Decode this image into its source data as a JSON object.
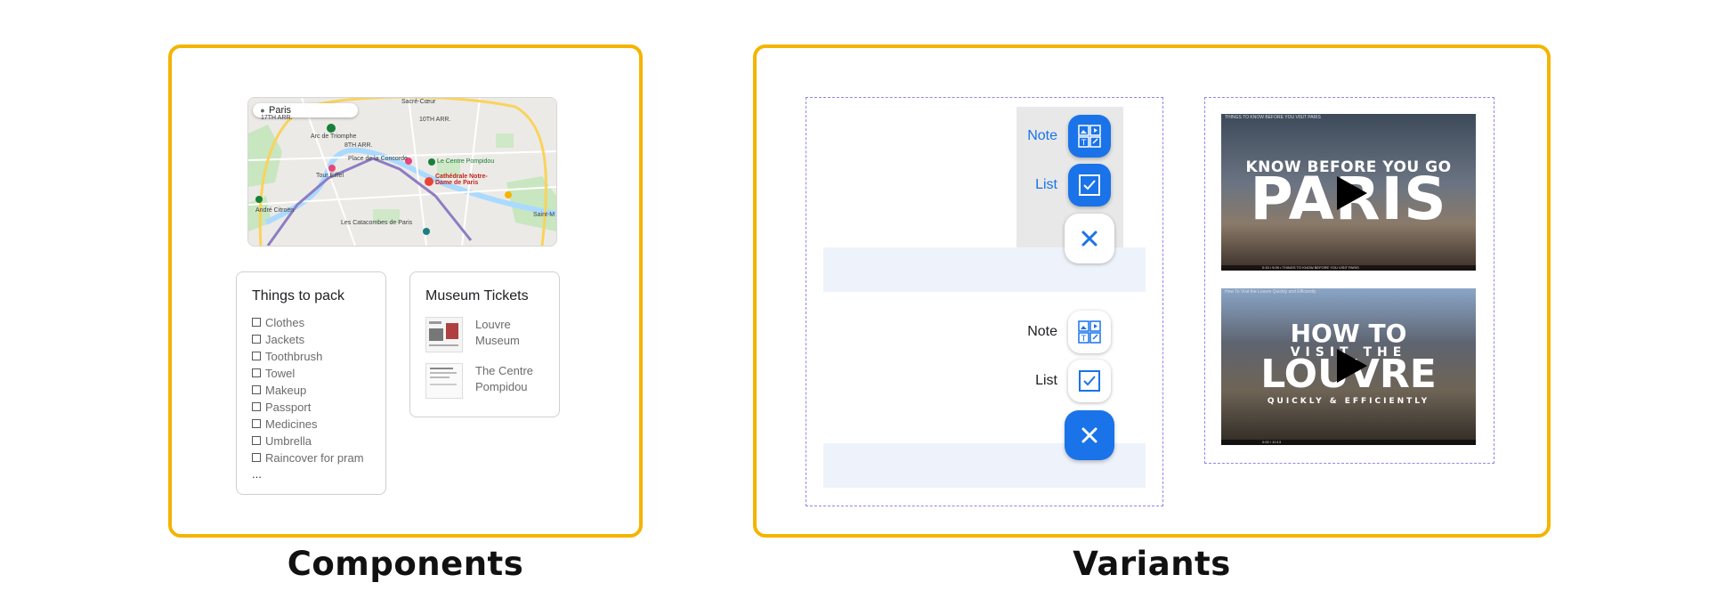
{
  "captions": {
    "components": "Components",
    "variants": "Variants"
  },
  "map": {
    "search": "Paris",
    "labels": {
      "sacre_coeur": "Sacré-Cœur",
      "tenth": "10TH ARR.",
      "seventeenth": "17TH ARR.",
      "arc": "Arc de Triomphe",
      "eighth": "8TH ARR.",
      "concorde": "Place de la Concorde",
      "pompidou": "Le Centre Pompidou",
      "cathedrale": "Cathédrale Notre-Dame de Paris",
      "eiffel": "Tour Eiffel",
      "andre": "André Citroën",
      "catacombes": "Les Catacombes de Paris",
      "saint_mandé": "Saint-M"
    }
  },
  "pack_card": {
    "title": "Things to pack",
    "items": [
      "Clothes",
      "Jackets",
      "Toothbrush",
      "Towel",
      "Makeup",
      "Passport",
      "Medicines",
      "Umbrella",
      "Raincover for pram"
    ],
    "more": "..."
  },
  "tickets_card": {
    "title": "Museum Tickets",
    "items": [
      "Louvre Museum",
      "The Centre Pompidou"
    ]
  },
  "fab_variant_a": {
    "note_label": "Note",
    "list_label": "List",
    "label_color": "#1a73e8"
  },
  "fab_variant_b": {
    "note_label": "Note",
    "list_label": "List",
    "label_color": "#202124"
  },
  "videos": [
    {
      "title": "THINGS TO KNOW BEFORE YOU VISIT PARIS",
      "line1": "KNOW BEFORE YOU GO",
      "line2": "PARIS",
      "controls": "0:15 / 9:09 • THINGS TO KNOW BEFORE YOU VISIT PARIS"
    },
    {
      "title": "How To Visit the Louvre Quickly and Efficiently",
      "line1": "HOW TO",
      "line2": "VISIT THE",
      "line3": "LOUVRE",
      "line4": "QUICKLY & EFFICIENTLY",
      "controls": "0:00 / 10:13"
    }
  ],
  "colors": {
    "panel_border": "#f4b400",
    "accent_blue": "#1a73e8",
    "dashed_border": "#8b87f0",
    "strip": "#eef2fb"
  },
  "icons": {
    "note": "note-media-icon",
    "list": "checkbox-icon",
    "close": "close-icon",
    "play": "play-icon"
  }
}
